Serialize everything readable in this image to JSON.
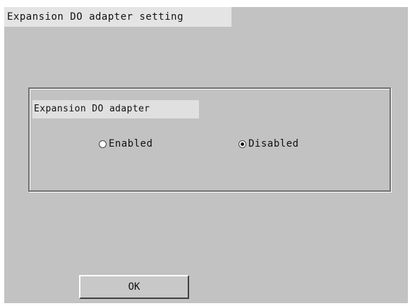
{
  "dialog": {
    "title": "Expansion DO adapter setting"
  },
  "group": {
    "label": "Expansion DO adapter",
    "options": [
      {
        "label": "Enabled",
        "selected": false
      },
      {
        "label": "Disabled",
        "selected": true
      }
    ]
  },
  "buttons": {
    "ok_label": "OK"
  }
}
